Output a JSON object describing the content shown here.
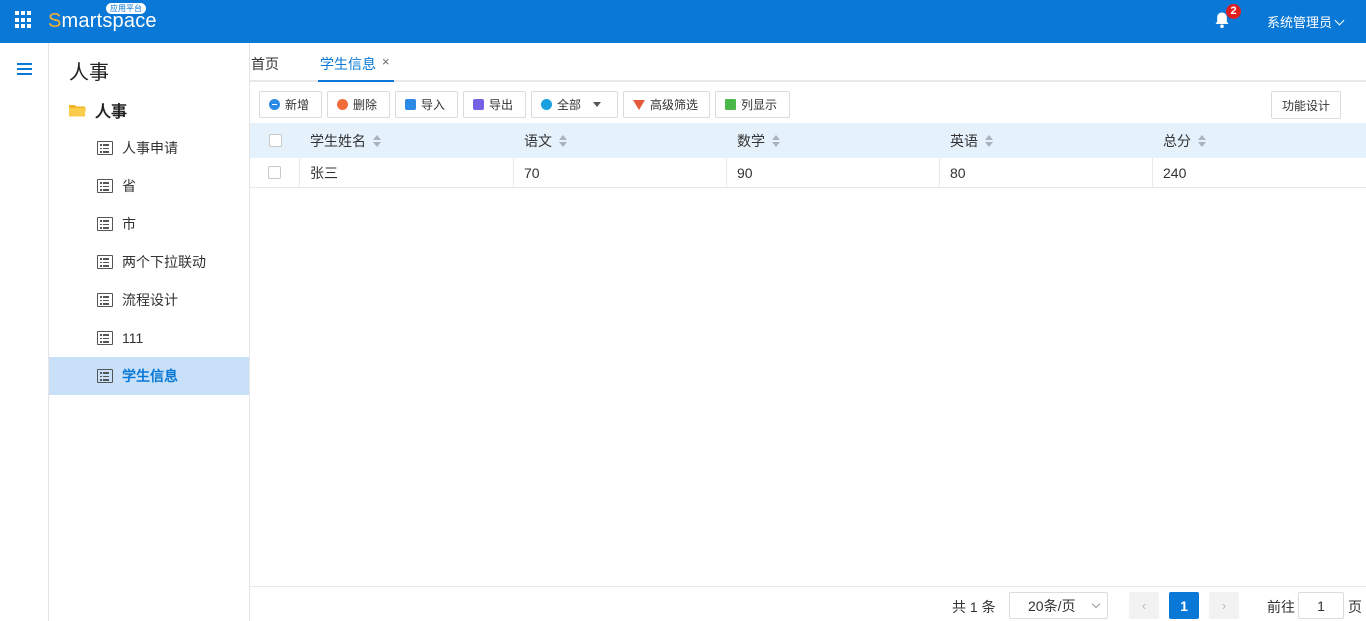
{
  "header": {
    "logo_first": "S",
    "logo_rest": "martspace",
    "logo_badge": "应用平台",
    "notifications": "2",
    "user": "系统管理员"
  },
  "sidebar": {
    "title": "人事",
    "folder": "人事",
    "items": [
      {
        "label": "人事申请"
      },
      {
        "label": "省"
      },
      {
        "label": "市"
      },
      {
        "label": "两个下拉联动"
      },
      {
        "label": "流程设计"
      },
      {
        "label": "111"
      },
      {
        "label": "学生信息"
      }
    ]
  },
  "tabs": {
    "home": "首页",
    "active": "学生信息",
    "close": "×"
  },
  "toolbar": {
    "add": "新增",
    "delete": "删除",
    "import": "导入",
    "export": "导出",
    "scope": "全部",
    "advanced_filter": "高级筛选",
    "columns": "列显示",
    "design": "功能设计"
  },
  "table": {
    "headers": [
      "学生姓名",
      "语文",
      "数学",
      "英语",
      "总分"
    ],
    "rows": [
      [
        "张三",
        "70",
        "90",
        "80",
        "240"
      ]
    ]
  },
  "pagination": {
    "total": "共 1 条",
    "page_size": "20条/页",
    "prev": "‹",
    "current": "1",
    "next": "›",
    "goto_label": "前往",
    "goto_value": "1",
    "goto_suffix": "页"
  },
  "colors": {
    "header_bg": "#0a78d6",
    "active_nav_bg": "#c8e1f8",
    "table_head_bg": "#e5f1fb"
  }
}
